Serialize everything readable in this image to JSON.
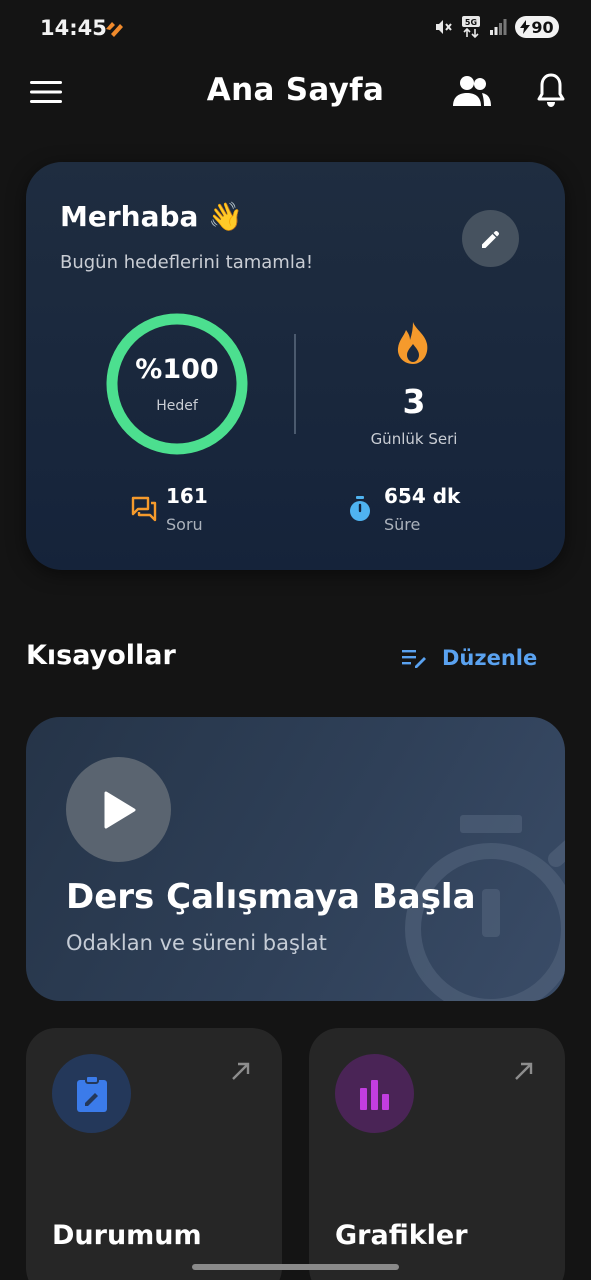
{
  "status_bar": {
    "time": "14:45",
    "network": "5G",
    "battery": "90"
  },
  "top_bar": {
    "title": "Ana Sayfa"
  },
  "greeting": {
    "title": "Merhaba 👋",
    "subtitle": "Bugün hedeflerini tamamla!",
    "goal": {
      "value": "%100",
      "label": "Hedef",
      "progress": 1.0
    },
    "streak": {
      "value": "3",
      "label": "Günlük Seri"
    },
    "questions": {
      "value": "161",
      "label": "Soru"
    },
    "time": {
      "value": "654 dk",
      "label": "Süre"
    }
  },
  "shortcuts": {
    "title": "Kısayollar",
    "edit_label": "Düzenle",
    "study": {
      "title": "Ders Çalışmaya Başla",
      "subtitle": "Odaklan ve süreni başlat"
    },
    "cards": [
      {
        "title": "Durumum",
        "icon": "clipboard-edit-icon",
        "color": "#3b7bea"
      },
      {
        "title": "Grafikler",
        "icon": "bar-chart-icon",
        "color": "#c23de0"
      }
    ]
  },
  "colors": {
    "background": "#141414",
    "accent_green": "#4cdf8f",
    "accent_blue": "#5aa2f0",
    "accent_orange": "#f59a2c"
  }
}
